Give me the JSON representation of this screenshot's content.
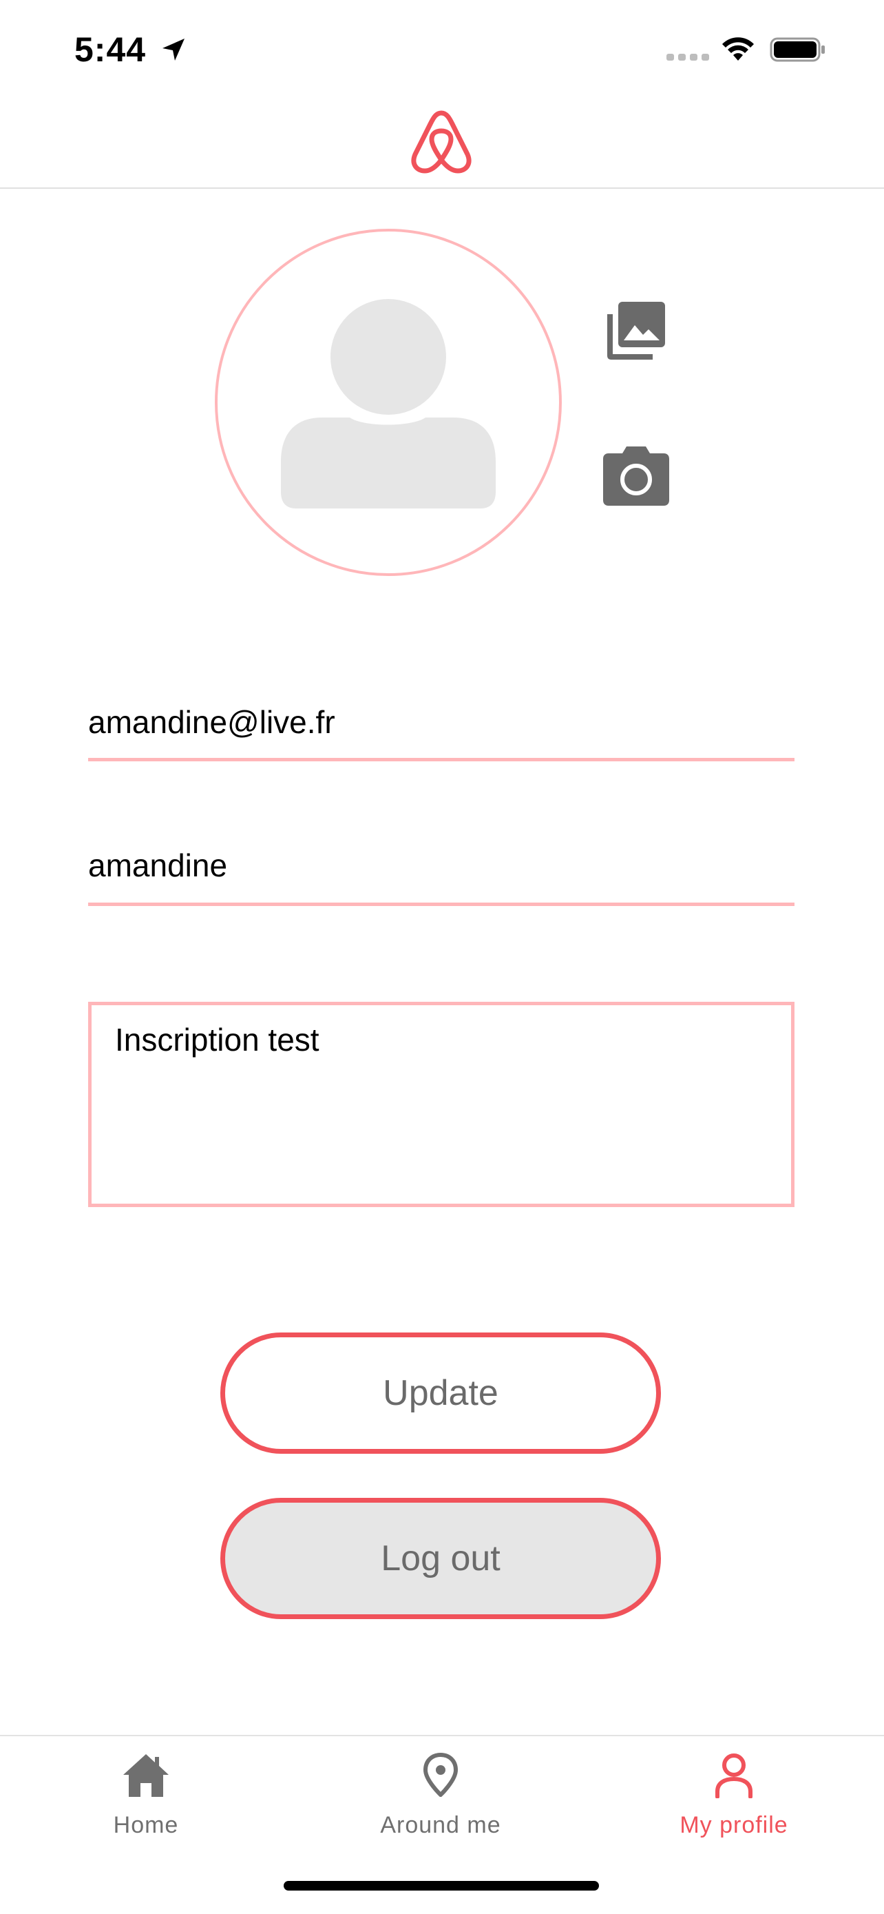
{
  "status_bar": {
    "time": "5:44"
  },
  "header": {
    "logo_icon": "airbnb-logo-icon",
    "brand_color": "#f0525a"
  },
  "avatar": {
    "placeholder_icon": "user-placeholder-icon"
  },
  "avatar_actions": {
    "gallery_icon": "photo-library-icon",
    "camera_icon": "camera-icon"
  },
  "form": {
    "email": "amandine@live.fr",
    "username": "amandine",
    "description": "Inscription test",
    "underline_color": "#ffb6b9"
  },
  "buttons": {
    "update_label": "Update",
    "logout_label": "Log out"
  },
  "tabbar": {
    "items": [
      {
        "label": "Home",
        "icon": "home-icon",
        "active": false
      },
      {
        "label": "Around me",
        "icon": "location-pin-icon",
        "active": false
      },
      {
        "label": "My profile",
        "icon": "user-icon",
        "active": true
      }
    ],
    "active_color": "#f0525a",
    "inactive_color": "#6f6f6f"
  }
}
